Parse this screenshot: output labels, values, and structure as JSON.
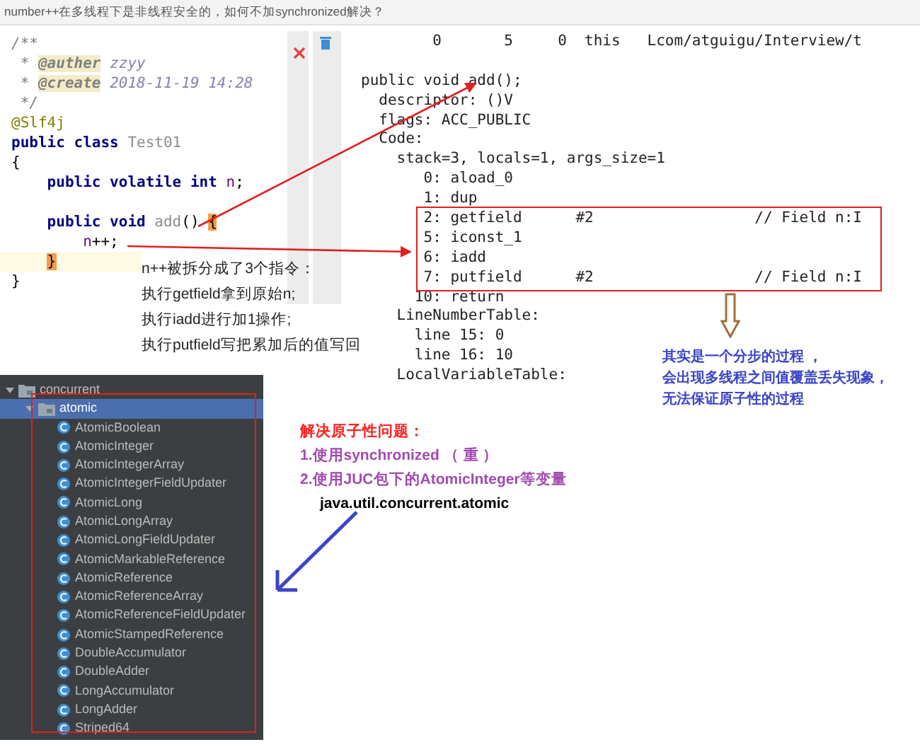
{
  "title": "number++在多线程下是非线程安全的，如何不加synchronized解决？",
  "code_editor": {
    "lines": [
      {
        "current": false,
        "tokens": [
          {
            "kind": "comment",
            "text": "/**"
          }
        ]
      },
      {
        "current": false,
        "tokens": [
          {
            "kind": "comment",
            "text": " * "
          },
          {
            "kind": "doc-tag",
            "text": "@auther"
          },
          {
            "kind": "doc-value",
            "text": " zzyy"
          }
        ]
      },
      {
        "current": false,
        "tokens": [
          {
            "kind": "comment",
            "text": " * "
          },
          {
            "kind": "doc-tag",
            "text": "@create"
          },
          {
            "kind": "doc-value",
            "text": " 2018-11-19 14:28"
          }
        ]
      },
      {
        "current": false,
        "tokens": [
          {
            "kind": "comment",
            "text": " */"
          }
        ]
      },
      {
        "current": false,
        "tokens": [
          {
            "kind": "annotation",
            "text": "@Slf4j"
          }
        ]
      },
      {
        "current": false,
        "tokens": [
          {
            "kind": "keyword",
            "text": "public class "
          },
          {
            "kind": "unused",
            "text": "Test01"
          }
        ]
      },
      {
        "current": false,
        "tokens": [
          {
            "kind": "plain",
            "text": "{"
          }
        ]
      },
      {
        "current": false,
        "tokens": [
          {
            "kind": "keyword",
            "text": "    public volatile int "
          },
          {
            "kind": "field",
            "text": "n"
          },
          {
            "kind": "plain",
            "text": ";"
          }
        ]
      },
      {
        "current": false
      },
      {
        "current": false,
        "tokens": [
          {
            "kind": "keyword",
            "text": "    public void "
          },
          {
            "kind": "unused",
            "text": "add"
          },
          {
            "kind": "plain",
            "text": "() "
          },
          {
            "kind": "brace-match",
            "text": "{"
          }
        ]
      },
      {
        "current": false,
        "tokens": [
          {
            "kind": "field",
            "text": "        n"
          },
          {
            "kind": "plain",
            "text": "++;"
          }
        ]
      },
      {
        "current": true,
        "tokens": [
          {
            "kind": "brace-match",
            "text": "    }"
          }
        ]
      },
      {
        "current": false,
        "tokens": [
          {
            "kind": "plain",
            "text": "}"
          }
        ]
      }
    ]
  },
  "bytecode": {
    "header": "        0       5     0  this   Lcom/atguigu/Interview/t",
    "lines": [
      "public void add();",
      "  descriptor: ()V",
      "  flags: ACC_PUBLIC",
      "  Code:",
      "    stack=3, locals=1, args_size=1",
      "       0: aload_0",
      "       1: dup",
      "       2: getfield      #2                  // Field n:I",
      "       5: iconst_1",
      "       6: iadd",
      "       7: putfield      #2                  // Field n:I",
      "      10: return",
      "    LineNumberTable:",
      "      line 15: 0",
      "      line 16: 10",
      "    LocalVariableTable:"
    ]
  },
  "step_note": [
    "n++被拆分成了3个指令：",
    "执行getfield拿到原始n;",
    "执行iadd进行加1操作;",
    "执行putfield写把累加后的值写回"
  ],
  "process_note": [
    "其实是一个分步的过程 ，",
    "会出现多线程之间值覆盖丢失现象，",
    "无法保证原子性的过程"
  ],
  "solution": {
    "heading": "解决原子性问题：",
    "items": [
      "1.使用synchronized （ 重 ）",
      "2.使用JUC包下的AtomicInteger等变量"
    ],
    "package": "java.util.concurrent.atomic"
  },
  "package_tree": [
    {
      "label": "concurrent",
      "kind": "package",
      "selected": false,
      "expanded": true,
      "children": [
        {
          "label": "atomic",
          "kind": "package",
          "selected": true,
          "expanded": true,
          "children": [
            {
              "label": "AtomicBoolean",
              "kind": "class",
              "selected": false
            },
            {
              "label": "AtomicInteger",
              "kind": "class",
              "selected": false
            },
            {
              "label": "AtomicIntegerArray",
              "kind": "class",
              "selected": false
            },
            {
              "label": "AtomicIntegerFieldUpdater",
              "kind": "class",
              "selected": false
            },
            {
              "label": "AtomicLong",
              "kind": "class",
              "selected": false
            },
            {
              "label": "AtomicLongArray",
              "kind": "class",
              "selected": false
            },
            {
              "label": "AtomicLongFieldUpdater",
              "kind": "class",
              "selected": false
            },
            {
              "label": "AtomicMarkableReference",
              "kind": "class",
              "selected": false
            },
            {
              "label": "AtomicReference",
              "kind": "class",
              "selected": false
            },
            {
              "label": "AtomicReferenceArray",
              "kind": "class",
              "selected": false
            },
            {
              "label": "AtomicReferenceFieldUpdater",
              "kind": "class",
              "selected": false
            },
            {
              "label": "AtomicStampedReference",
              "kind": "class",
              "selected": false
            },
            {
              "label": "DoubleAccumulator",
              "kind": "class",
              "selected": false
            },
            {
              "label": "DoubleAdder",
              "kind": "class",
              "selected": false
            },
            {
              "label": "LongAccumulator",
              "kind": "class",
              "selected": false
            },
            {
              "label": "LongAdder",
              "kind": "class",
              "selected": false
            },
            {
              "label": "Striped64",
              "kind": "class",
              "selected": false
            }
          ]
        }
      ]
    }
  ]
}
